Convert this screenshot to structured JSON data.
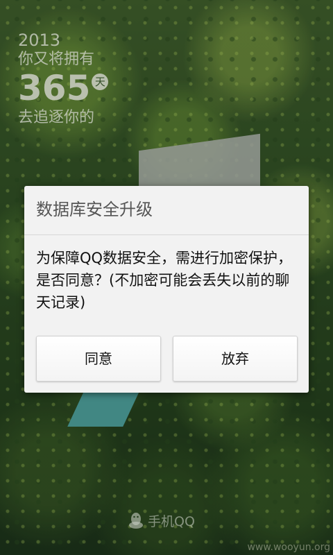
{
  "background": {
    "greeting": {
      "year": "2013",
      "line1": "你又将拥有",
      "big_number": "365",
      "day_badge": "天",
      "line3": "去追逐你的"
    }
  },
  "dialog": {
    "title": "数据库安全升级",
    "message": "为保障QQ数据安全，需进行加密保护，是否同意？(不加密可能会丢失以前的聊天记录)",
    "buttons": {
      "agree": "同意",
      "abandon": "放弃"
    }
  },
  "footer": {
    "brand": "手机QQ",
    "brand_icon": "qq-penguin-icon",
    "watermark": "www.wooyun.org"
  },
  "colors": {
    "dialog_bg": "#f2f2f2",
    "title_text": "#555555",
    "accent_teal": "#4a9a96"
  }
}
